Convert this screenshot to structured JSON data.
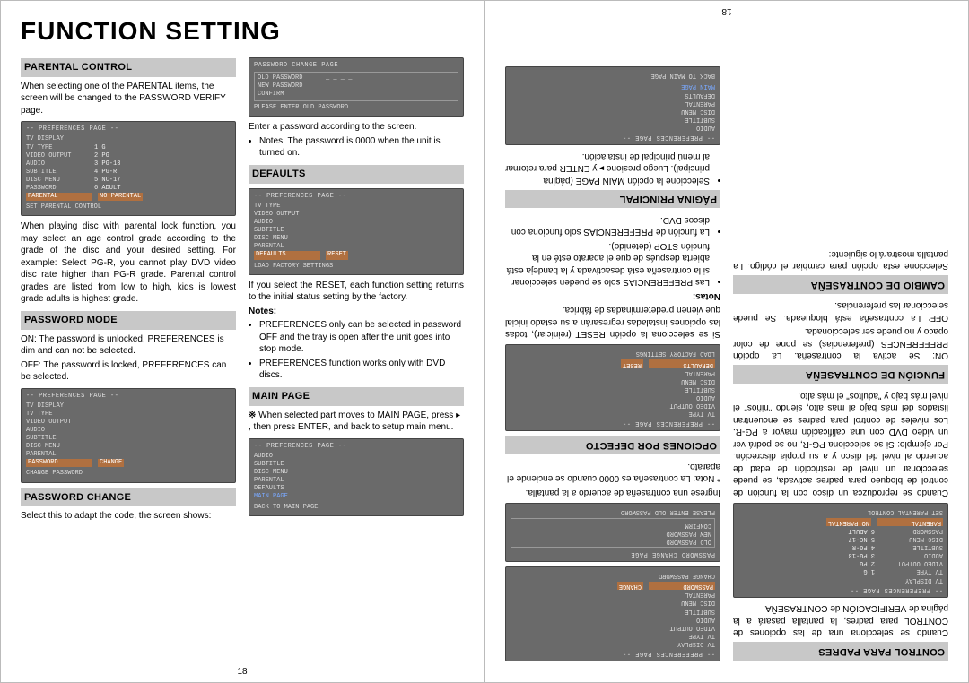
{
  "left": {
    "title": "FUNCTION SETTING",
    "pagenum": "18",
    "sec_parental_control": "PARENTAL CONTROL",
    "parental_intro": "When selecting one of the PARENTAL items, the screen will be changed to the PASSWORD VERIFY page.",
    "parental_body": "When playing disc with parental lock function, you may select an age control grade according to the grade of the disc and your desired setting. For example: Select PG-R, you cannot play DVD video disc rate higher than PG-R grade. Parental control grades are listed from low to high, kids is lowest grade adults is highest grade.",
    "sec_password_mode": "PASSWORD MODE",
    "pwmode_on": "ON: The password is unlocked, PREFERENCES is dim and can not be selected.",
    "pwmode_off": "OFF: The password is locked, PREFERENCES can be selected.",
    "sec_password_change": "PASSWORD CHANGE",
    "pwchange_body": "Select this to adapt the code, the screen shows:",
    "col2_enter": "Enter a password according to the screen.",
    "col2_note_bullet": "Notes: The password is 0000 when the unit is turned on.",
    "sec_defaults": "DEFAULTS",
    "defaults_body": "If you select the RESET, each function setting returns to the initial status setting by the factory.",
    "notes_label": "Notes:",
    "notes1": "PREFERENCES only can be selected in password OFF and the tray is open after the unit goes into stop mode.",
    "notes2": "PREFERENCES function works only with DVD discs.",
    "sec_mainpage": "MAIN PAGE",
    "mainpage_body": "When selected part moves to MAIN PAGE, press ▸ , then press ENTER, and back to setup main menu.",
    "osd_pref_header": "-- PREFERENCES PAGE --",
    "osd_items": {
      "tv_display": "TV DISPLAY",
      "tv_type": "TV TYPE",
      "video_output": "VIDEO OUTPUT",
      "audio": "AUDIO",
      "subtitle": "SUBTITLE",
      "disc_menu": "DISC MENU",
      "password": "PASSWORD",
      "parental": "PARENTAL",
      "defaults": "DEFAULTS"
    },
    "osd_grades": {
      "g1": "1 G",
      "g2": "2 PG",
      "g3": "3 PG-13",
      "g4": "4 PG-R",
      "g5": "5 NC-17",
      "g6": "6 ADULT",
      "g7": "NO PARENTAL"
    },
    "osd_footer_parental": "SET PARENTAL CONTROL",
    "osd_pw_page": "PASSWORD CHANGE PAGE",
    "osd_old_pw": "OLD PASSWORD",
    "osd_new_pw": "NEW PASSWORD",
    "osd_confirm": "CONFIRM",
    "osd_enter_old": "PLEASE ENTER OLD PASSWORD",
    "osd_change_pw": "CHANGE PASSWORD",
    "osd_change": "CHANGE",
    "osd_load_factory": "LOAD FACTORY SETTINGS",
    "osd_reset": "RESET",
    "osd_mainpage": "MAIN PAGE",
    "osd_back_main": "BACK TO MAIN PAGE"
  },
  "right": {
    "pagenum": "18",
    "sec_control_padres": "CONTROL PARA PADRES",
    "cpp_intro": "Cuando se selecciona una de las opciones de CONTROL para padres, la pantalla pasará a la página de VERIFICACIÓN de CONTRASEÑA.",
    "cpp_body": "Cuando se reproduzca un disco con la función de control de bloqueo para padres activada, se puede seleccionar un nivel de restricción de edad de acuerdo al nivel del disco y a su propia discreción. Por ejemplo: Si se selecciona PG-R, no se podrá ver un video DVD con una calificación mayor a PG-R. Los niveles de control para padres se encuentran listados del más bajo al más alto, siendo \"niños\" el nivel más bajo y \"adultos\" el más alto.",
    "sec_funcion_contra": "FUNCIÓN DE CONTRASEÑA",
    "fcon_on": "ON: Se activa la contraseña. La opción PREFERENCES (preferencias) se pone de color opaco y no puede ser seleccionada.",
    "fcon_off": "OFF: La contraseña está bloqueada. Se puede seleccionar las preferencias.",
    "sec_cambio": "CAMBIO DE CONTRASEÑA",
    "cambio_body": "Seleccione esta opción para cambiar el código. La pantalla mostrará lo siguiente:",
    "cambio_body2": "Ingrese una contraseña de acuerdo a la pantalla.",
    "cambio_nota": "* Nota: La contraseña es 0000 cuando se enciende el aparato.",
    "sec_opciones_def": "OPCIONES POR DEFECTO",
    "opdef_body": "Si se selecciona la opción RESET (reiniciar), todas las opciones instaladas regresarán a su estado inicial que vienen predeterminadas de fábrica.",
    "notas_label": "Notas:",
    "nota1": "Las PREFERENCIAS solo se pueden seleccionar si la contraseña está desactivada y la bandeja está abierta después de que el aparato esté en la función STOP (detenido).",
    "nota2": "La función de PREFERENCIAS solo funciona con discos DVD.",
    "sec_pagina_principal": "PÁGINA PRINCIPAL",
    "pp_body": "Seleccione la opción MAIN PAGE (página principal). Luego presione ▸ y ENTER para retornar al menú principal de instalación."
  }
}
